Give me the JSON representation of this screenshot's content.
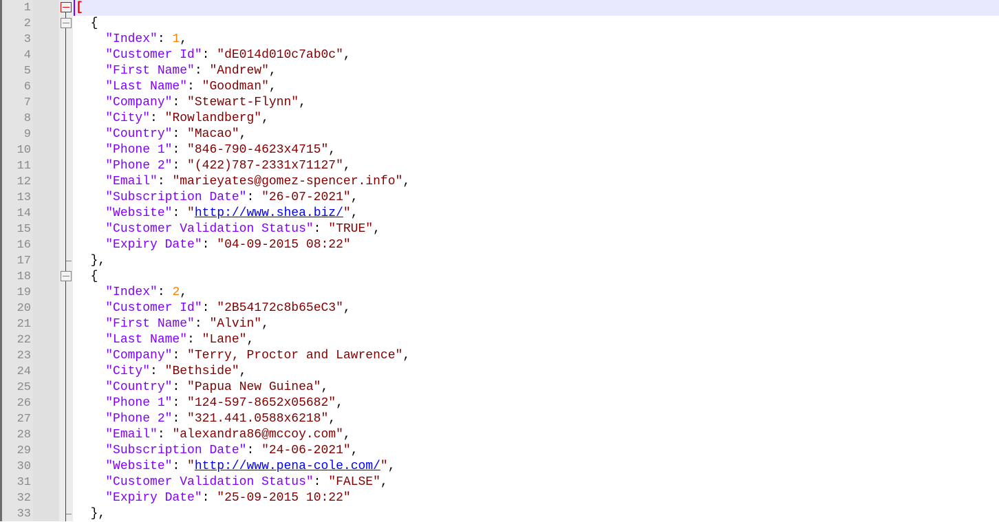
{
  "editor": {
    "colors": {
      "key": "#8000ff",
      "string": "#800000",
      "number": "#ff8000",
      "bracket": "#ff0000",
      "link": "#0000ff",
      "current_line": "#e8e8ff",
      "fold_marker": "#e00000"
    },
    "lines": [
      {
        "n": "1",
        "open": "[",
        "current": true
      },
      {
        "n": "2",
        "open": "{"
      },
      {
        "n": "3",
        "key": "\"Index\"",
        "num": "1",
        "comma": ","
      },
      {
        "n": "4",
        "key": "\"Customer Id\"",
        "str": "\"dE014d010c7ab0c\"",
        "comma": ","
      },
      {
        "n": "5",
        "key": "\"First Name\"",
        "str": "\"Andrew\"",
        "comma": ","
      },
      {
        "n": "6",
        "key": "\"Last Name\"",
        "str": "\"Goodman\"",
        "comma": ","
      },
      {
        "n": "7",
        "key": "\"Company\"",
        "str": "\"Stewart-Flynn\"",
        "comma": ","
      },
      {
        "n": "8",
        "key": "\"City\"",
        "str": "\"Rowlandberg\"",
        "comma": ","
      },
      {
        "n": "9",
        "key": "\"Country\"",
        "str": "\"Macao\"",
        "comma": ","
      },
      {
        "n": "10",
        "key": "\"Phone 1\"",
        "str": "\"846-790-4623x4715\"",
        "comma": ","
      },
      {
        "n": "11",
        "key": "\"Phone 2\"",
        "str": "\"(422)787-2331x71127\"",
        "comma": ","
      },
      {
        "n": "12",
        "key": "\"Email\"",
        "str": "\"marieyates@gomez-spencer.info\"",
        "comma": ","
      },
      {
        "n": "13",
        "key": "\"Subscription Date\"",
        "str": "\"26-07-2021\"",
        "comma": ","
      },
      {
        "n": "14",
        "key": "\"Website\"",
        "url": "http://www.shea.biz/",
        "comma": ","
      },
      {
        "n": "15",
        "key": "\"Customer Validation Status\"",
        "str": "\"TRUE\"",
        "comma": ","
      },
      {
        "n": "16",
        "key": "\"Expiry Date\"",
        "str": "\"04-09-2015 08:22\"",
        "comma": ""
      },
      {
        "n": "17",
        "close": "},"
      },
      {
        "n": "18",
        "open": "{"
      },
      {
        "n": "19",
        "key": "\"Index\"",
        "num": "2",
        "comma": ","
      },
      {
        "n": "20",
        "key": "\"Customer Id\"",
        "str": "\"2B54172c8b65eC3\"",
        "comma": ","
      },
      {
        "n": "21",
        "key": "\"First Name\"",
        "str": "\"Alvin\"",
        "comma": ","
      },
      {
        "n": "22",
        "key": "\"Last Name\"",
        "str": "\"Lane\"",
        "comma": ","
      },
      {
        "n": "23",
        "key": "\"Company\"",
        "str": "\"Terry, Proctor and Lawrence\"",
        "comma": ","
      },
      {
        "n": "24",
        "key": "\"City\"",
        "str": "\"Bethside\"",
        "comma": ","
      },
      {
        "n": "25",
        "key": "\"Country\"",
        "str": "\"Papua New Guinea\"",
        "comma": ","
      },
      {
        "n": "26",
        "key": "\"Phone 1\"",
        "str": "\"124-597-8652x05682\"",
        "comma": ","
      },
      {
        "n": "27",
        "key": "\"Phone 2\"",
        "str": "\"321.441.0588x6218\"",
        "comma": ","
      },
      {
        "n": "28",
        "key": "\"Email\"",
        "str": "\"alexandra86@mccoy.com\"",
        "comma": ","
      },
      {
        "n": "29",
        "key": "\"Subscription Date\"",
        "str": "\"24-06-2021\"",
        "comma": ","
      },
      {
        "n": "30",
        "key": "\"Website\"",
        "url": "http://www.pena-cole.com/",
        "comma": ","
      },
      {
        "n": "31",
        "key": "\"Customer Validation Status\"",
        "str": "\"FALSE\"",
        "comma": ","
      },
      {
        "n": "32",
        "key": "\"Expiry Date\"",
        "str": "\"25-09-2015 10:22\"",
        "comma": ""
      },
      {
        "n": "33",
        "close": "},"
      }
    ]
  }
}
